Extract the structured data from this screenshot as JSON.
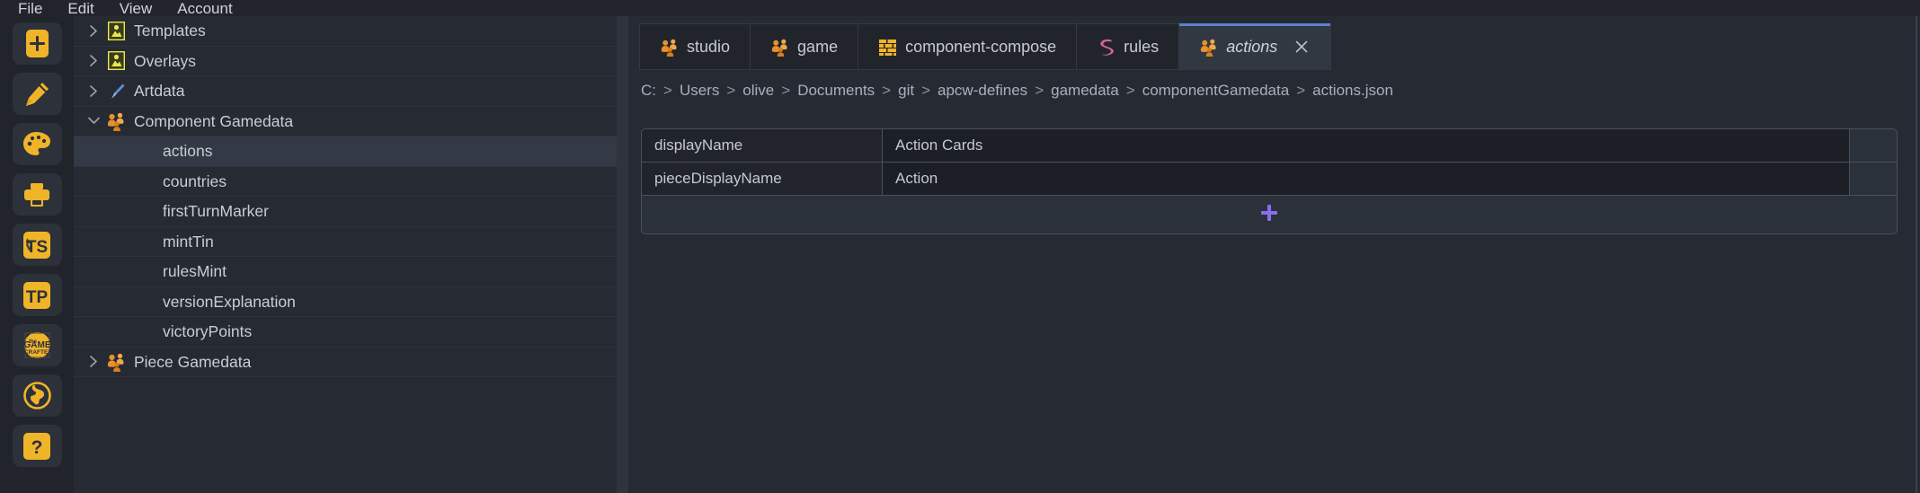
{
  "menubar": {
    "items": [
      {
        "label": "File"
      },
      {
        "label": "Edit"
      },
      {
        "label": "View"
      },
      {
        "label": "Account"
      }
    ]
  },
  "rail": {
    "buttons": [
      {
        "name": "new-card-button",
        "icon": "card-plus-icon"
      },
      {
        "name": "edit-pencil-button",
        "icon": "pencil-icon"
      },
      {
        "name": "palette-button",
        "icon": "palette-icon"
      },
      {
        "name": "print-button",
        "icon": "printer-icon"
      },
      {
        "name": "ts-button",
        "icon": "ts-badge-icon"
      },
      {
        "name": "tp-button",
        "icon": "tp-badge-icon"
      },
      {
        "name": "game-crafter-button",
        "icon": "game-crafter-logo-icon"
      },
      {
        "name": "globe-button",
        "icon": "globe-icon"
      },
      {
        "name": "help-button",
        "icon": "question-mark-icon"
      }
    ]
  },
  "tree": {
    "items": [
      {
        "label": "Templates",
        "icon": "template-image-icon",
        "twisty": "collapsed",
        "depth": 0,
        "selected": false
      },
      {
        "label": "Overlays",
        "icon": "template-image-icon",
        "twisty": "collapsed",
        "depth": 0,
        "selected": false
      },
      {
        "label": "Artdata",
        "icon": "paintbrush-icon",
        "twisty": "collapsed",
        "depth": 0,
        "selected": false
      },
      {
        "label": "Component Gamedata",
        "icon": "meeples-icon",
        "twisty": "expanded",
        "depth": 0,
        "selected": false
      },
      {
        "label": "actions",
        "icon": "none",
        "twisty": "none",
        "depth": 1,
        "selected": true
      },
      {
        "label": "countries",
        "icon": "none",
        "twisty": "none",
        "depth": 1,
        "selected": false
      },
      {
        "label": "firstTurnMarker",
        "icon": "none",
        "twisty": "none",
        "depth": 1,
        "selected": false
      },
      {
        "label": "mintTin",
        "icon": "none",
        "twisty": "none",
        "depth": 1,
        "selected": false
      },
      {
        "label": "rulesMint",
        "icon": "none",
        "twisty": "none",
        "depth": 1,
        "selected": false
      },
      {
        "label": "versionExplanation",
        "icon": "none",
        "twisty": "none",
        "depth": 1,
        "selected": false
      },
      {
        "label": "victoryPoints",
        "icon": "none",
        "twisty": "none",
        "depth": 1,
        "selected": false
      },
      {
        "label": "Piece Gamedata",
        "icon": "meeples-icon",
        "twisty": "collapsed",
        "depth": 0,
        "selected": false
      }
    ]
  },
  "editor": {
    "tabs": [
      {
        "label": "studio",
        "icon": "meeples-icon",
        "active": false,
        "closable": false
      },
      {
        "label": "game",
        "icon": "meeples-icon",
        "active": false,
        "closable": false
      },
      {
        "label": "component-compose",
        "icon": "brick-wall-icon",
        "active": false,
        "closable": false
      },
      {
        "label": "rules",
        "icon": "sass-s-icon",
        "active": false,
        "closable": false
      },
      {
        "label": "actions",
        "icon": "meeples-icon",
        "active": true,
        "closable": true
      }
    ],
    "breadcrumb": {
      "separator": ">",
      "parts": [
        "C:",
        "Users",
        "olive",
        "Documents",
        "git",
        "apcw-defines",
        "gamedata",
        "componentGamedata",
        "actions.json"
      ]
    },
    "table": {
      "rows": [
        {
          "key": "displayName",
          "value": "Action Cards"
        },
        {
          "key": "pieceDisplayName",
          "value": "Action"
        }
      ],
      "add_row_icon": "plus-icon"
    }
  },
  "colors": {
    "background": "#262a33",
    "panel": "#21252b",
    "accent_yellow": "#f0b429",
    "accent_orange": "#e8912d",
    "accent_blue": "#5e81c9",
    "accent_purple": "#8b6df0",
    "accent_pink": "#cc6699",
    "text_primary": "#c8cdd6",
    "border": "#4a515c",
    "selected_row": "#333a45"
  }
}
